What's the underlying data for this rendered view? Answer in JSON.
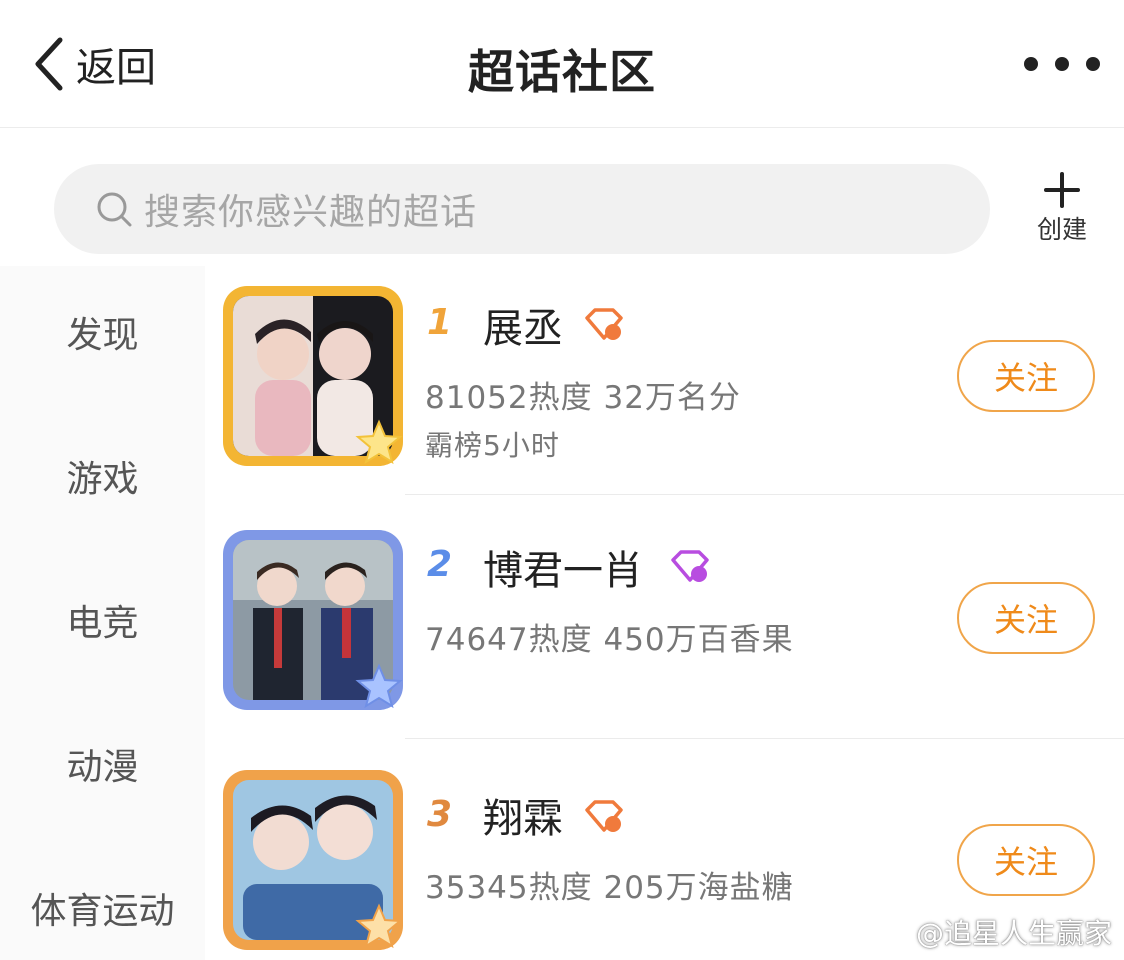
{
  "header": {
    "back_label": "返回",
    "title": "超话社区"
  },
  "search": {
    "placeholder": "搜索你感兴趣的超话"
  },
  "create_label": "创建",
  "sidebar": {
    "items": [
      {
        "label": "发现"
      },
      {
        "label": "游戏"
      },
      {
        "label": "电竞"
      },
      {
        "label": "动漫"
      },
      {
        "label": "体育运动"
      }
    ]
  },
  "topics": [
    {
      "rank": "1",
      "rank_color": "#f0a43a",
      "name": "展丞",
      "badge_color": "#f07a3c",
      "stats": "81052热度 32万名分",
      "sub": "霸榜5小时",
      "follow_label": "关注",
      "frame_color": "#f3b533"
    },
    {
      "rank": "2",
      "rank_color": "#5b8de8",
      "name": "博君一肖",
      "badge_color": "#b84de0",
      "stats": "74647热度 450万百香果",
      "sub": "",
      "follow_label": "关注",
      "frame_color": "#7f98e6"
    },
    {
      "rank": "3",
      "rank_color": "#e0893f",
      "name": "翔霖",
      "badge_color": "#f07a3c",
      "stats": "35345热度 205万海盐糖",
      "sub": "",
      "follow_label": "关注",
      "frame_color": "#f0a24a"
    }
  ],
  "watermark": "@追星人生赢家",
  "colors": {
    "accent": "#ef8a1a",
    "follow_border": "#f0a54a"
  }
}
